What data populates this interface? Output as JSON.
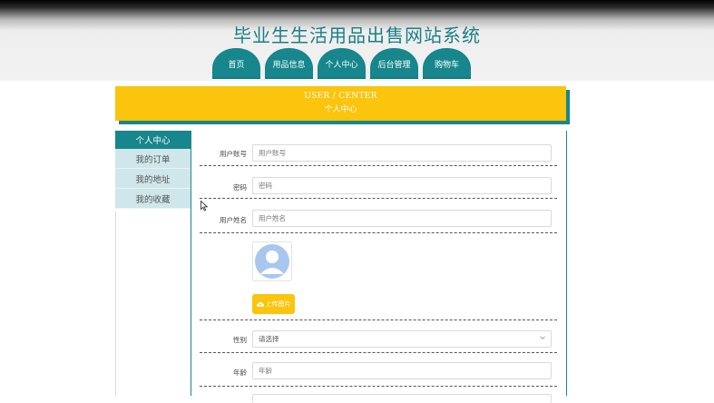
{
  "site": {
    "title": "毕业生生活用品出售网站系统"
  },
  "nav": {
    "tabs": [
      {
        "label": "首页"
      },
      {
        "label": "用品信息"
      },
      {
        "label": "个人中心"
      },
      {
        "label": "后台管理"
      },
      {
        "label": "购物车"
      }
    ],
    "active_index": 2
  },
  "banner": {
    "en": "USER / CENTER",
    "zh": "个人中心"
  },
  "sidebar": {
    "heading": "个人中心",
    "items": [
      {
        "label": "我的订单"
      },
      {
        "label": "我的地址"
      },
      {
        "label": "我的收藏"
      }
    ]
  },
  "form": {
    "account": {
      "label": "用户账号",
      "placeholder": "用户账号"
    },
    "password": {
      "label": "密码",
      "placeholder": "密码"
    },
    "name": {
      "label": "用户姓名",
      "placeholder": "用户姓名"
    },
    "upload": {
      "label": "上传图片",
      "icon": "upload-icon"
    },
    "gender": {
      "label": "性别",
      "value": "请选择"
    },
    "age": {
      "label": "年龄",
      "placeholder": "年龄"
    }
  },
  "colors": {
    "accent": "#17868d",
    "highlight": "#fbc40d",
    "sidebar_item": "#cfe7ea"
  }
}
